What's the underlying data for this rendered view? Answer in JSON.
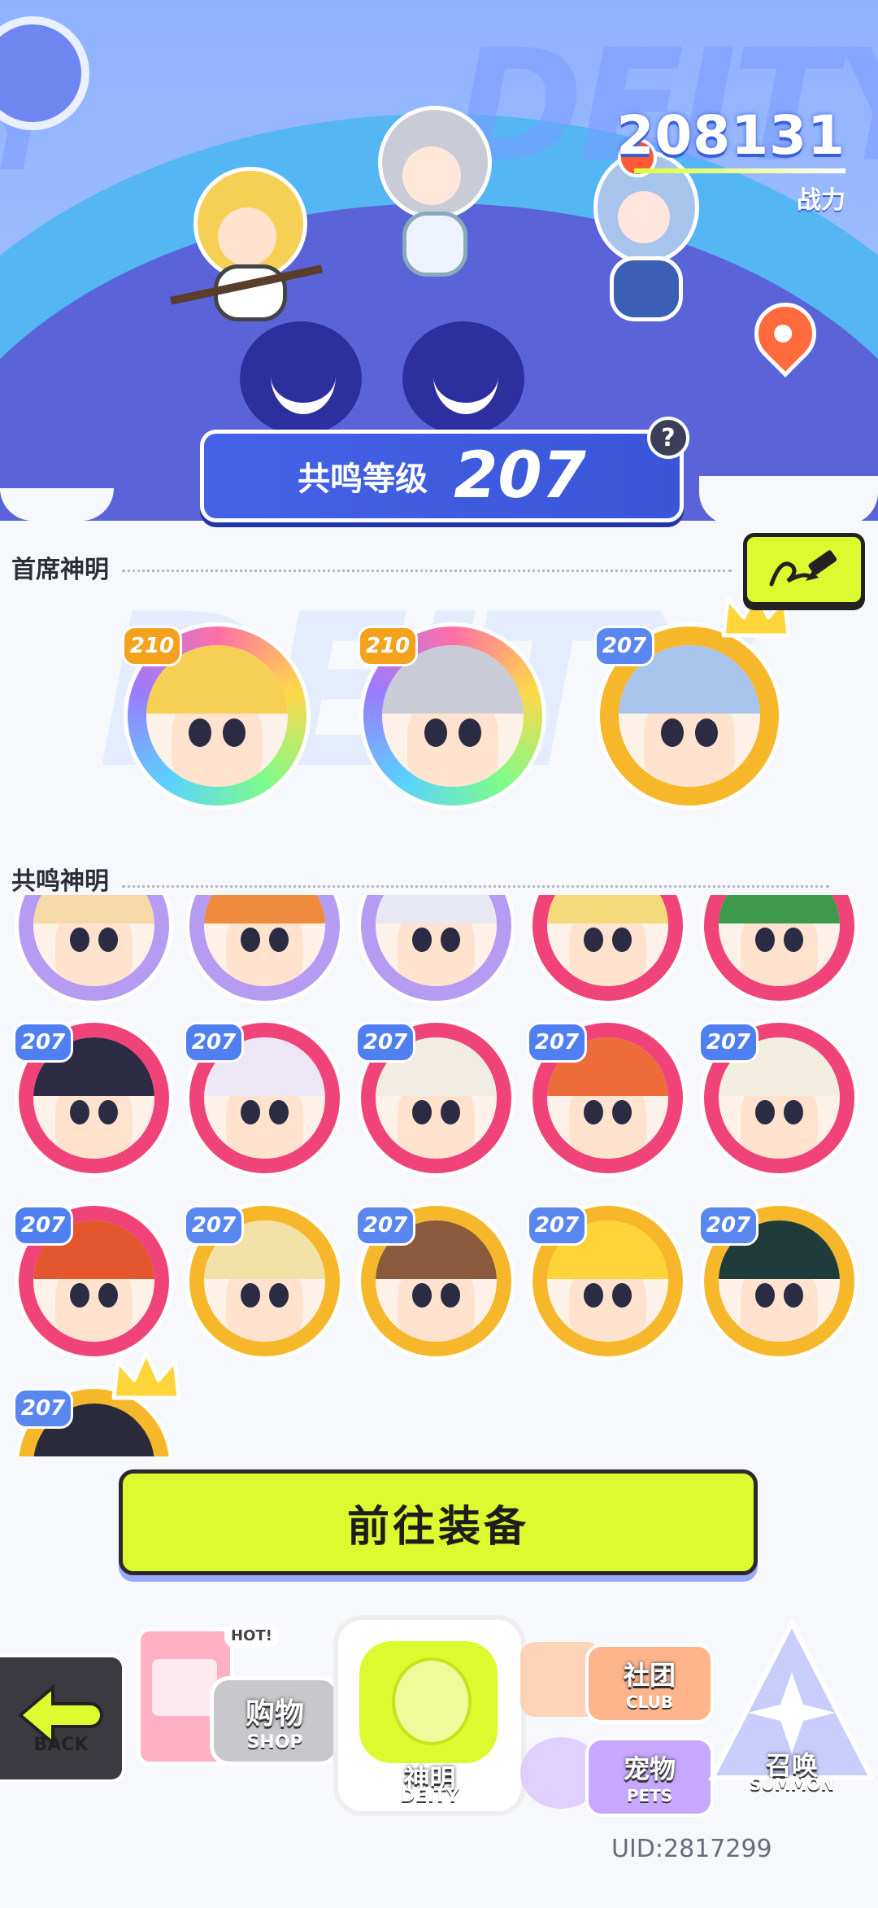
{
  "header": {
    "power_value": "208131",
    "power_label": "战力"
  },
  "resonance": {
    "level_label": "共鸣等级",
    "level_value": "207",
    "help_label": "?"
  },
  "chief_section": {
    "title": "首席神明",
    "edit_icon": "pencil-icon",
    "deities": [
      {
        "level": "210",
        "frame": "rainbow",
        "hair": "#f6cf55"
      },
      {
        "level": "210",
        "frame": "rainbow",
        "hair": "#c9ccd6"
      },
      {
        "level": "207",
        "frame": "gold",
        "hair": "#a9c4ec",
        "crowned": true
      }
    ]
  },
  "resonance_section": {
    "title": "共鸣神明",
    "rows": [
      [
        {
          "level": "",
          "frame": "violet",
          "hair": "#f6d9a9"
        },
        {
          "level": "",
          "frame": "violet",
          "hair": "#f08a3c"
        },
        {
          "level": "",
          "frame": "violet",
          "hair": "#e8e8f2"
        },
        {
          "level": "",
          "frame": "pink",
          "hair": "#f4da7a"
        },
        {
          "level": "",
          "frame": "pink",
          "hair": "#3c9a4a"
        }
      ],
      [
        {
          "level": "207",
          "frame": "pink",
          "hair": "#2d2b44"
        },
        {
          "level": "207",
          "frame": "pink",
          "hair": "#ece6f5"
        },
        {
          "level": "207",
          "frame": "pink",
          "hair": "#f1ede4"
        },
        {
          "level": "207",
          "frame": "pink",
          "hair": "#ee6b3a"
        },
        {
          "level": "207",
          "frame": "pink",
          "hair": "#f4eee0"
        }
      ],
      [
        {
          "level": "207",
          "frame": "pink",
          "hair": "#e3562e"
        },
        {
          "level": "207",
          "frame": "gold",
          "hair": "#f3e2a8"
        },
        {
          "level": "207",
          "frame": "gold",
          "hair": "#8b5a3c"
        },
        {
          "level": "207",
          "frame": "gold",
          "hair": "#ffd33a"
        },
        {
          "level": "207",
          "frame": "gold",
          "hair": "#1f3b3a"
        }
      ],
      [
        {
          "level": "207",
          "frame": "gold",
          "hair": "#2b2a3a",
          "crowned": true
        }
      ]
    ]
  },
  "equip_button": "前往装备",
  "nav": {
    "back": "BACK",
    "shop_cn": "购物",
    "shop_en": "SHOP",
    "shop_tag": "HOT!",
    "deity_cn": "神明",
    "deity_en": "DEITY",
    "club_cn": "社团",
    "club_en": "CLUB",
    "pets_cn": "宠物",
    "pets_en": "PETS",
    "summon_cn": "召唤",
    "summon_en": "SUMMON"
  },
  "uid": "UID:2817299",
  "colors": {
    "accent_yellow": "#dcfa2f",
    "level_blue": "#4463e6",
    "frame_pink": "#f0437a",
    "frame_gold": "#f6b82a",
    "frame_violet": "#b59cf2"
  }
}
